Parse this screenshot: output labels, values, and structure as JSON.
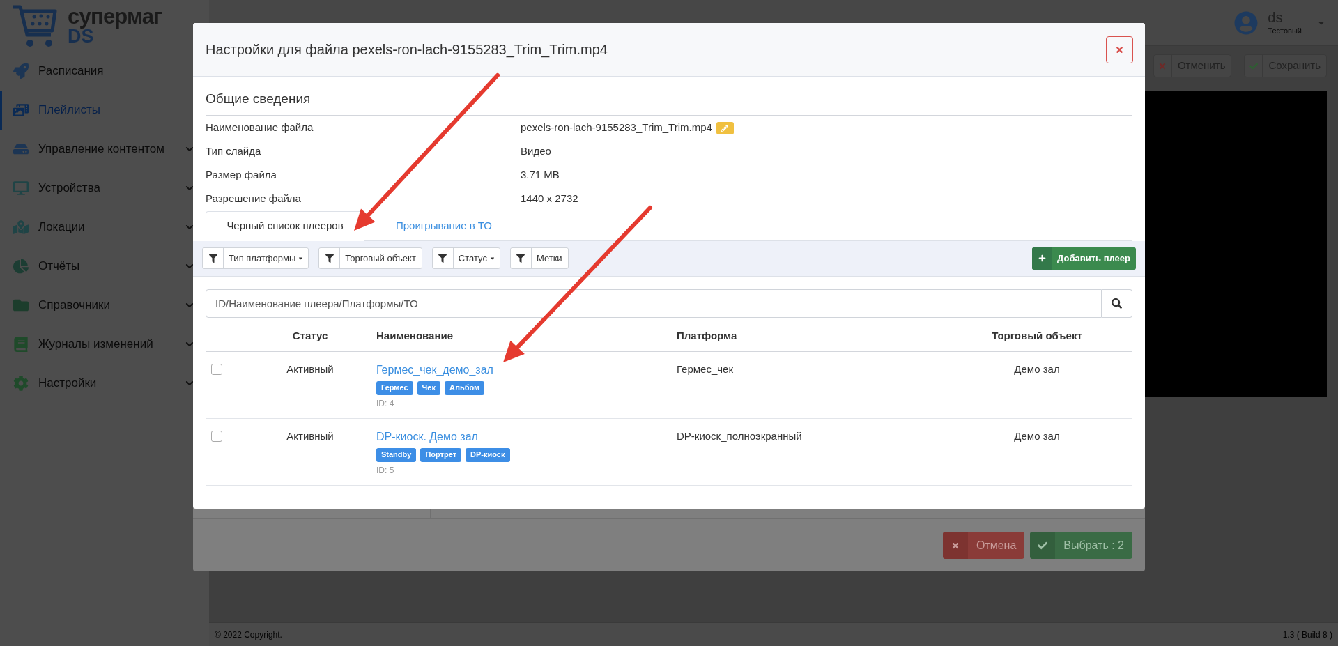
{
  "logo": {
    "line1": "супермаг",
    "line2": "DS"
  },
  "sidebar": {
    "items": [
      {
        "label": "Расписания",
        "selected": false,
        "expandable": false
      },
      {
        "label": "Плейлисты",
        "selected": true,
        "expandable": false
      },
      {
        "label": "Управление контентом",
        "selected": false,
        "expandable": true
      },
      {
        "label": "Устройства",
        "selected": false,
        "expandable": true
      },
      {
        "label": "Локации",
        "selected": false,
        "expandable": true
      },
      {
        "label": "Отчёты",
        "selected": false,
        "expandable": true
      },
      {
        "label": "Справочники",
        "selected": false,
        "expandable": true
      },
      {
        "label": "Журналы изменений",
        "selected": false,
        "expandable": true
      },
      {
        "label": "Настройки",
        "selected": false,
        "expandable": true
      }
    ]
  },
  "user": {
    "name": "ds",
    "role": "Тестовый"
  },
  "toolbar": [
    {
      "label": "Отменить",
      "kind": "cancel"
    },
    {
      "label": "Сохранить",
      "kind": "save"
    }
  ],
  "footer": {
    "copyright": "© 2022 Copyright.",
    "version": "1.3 ( Build 8 )"
  },
  "back_dialog": {
    "buttons": [
      {
        "label": "Отмена",
        "kind": "cancel"
      },
      {
        "label": "Выбрать : 2",
        "kind": "confirm"
      }
    ]
  },
  "dialog": {
    "title": "Настройки для файла pexels-ron-lach-9155283_Trim_Trim.mp4",
    "section_title": "Общие сведения",
    "info": [
      {
        "label": "Наименование файла",
        "value": "pexels-ron-lach-9155283_Trim_Trim.mp4",
        "editable": true
      },
      {
        "label": "Тип слайда",
        "value": "Видео",
        "editable": false
      },
      {
        "label": "Размер файла",
        "value": "3.71 MB",
        "editable": false
      },
      {
        "label": "Разрешение файла",
        "value": "1440 x 2732",
        "editable": false
      }
    ],
    "tabs": [
      {
        "label": "Черный список плееров",
        "selected": true
      },
      {
        "label": "Проигрывание в ТО",
        "selected": false
      }
    ],
    "filters": [
      {
        "label": "Тип платформы",
        "dropdown": true
      },
      {
        "label": "Торговый объект",
        "dropdown": false
      },
      {
        "label": "Статус",
        "dropdown": true
      },
      {
        "label": "Метки",
        "dropdown": false
      }
    ],
    "add_button": "Добавить плеер",
    "search": {
      "placeholder": "ID/Наименование плеера/Платформы/ТО"
    },
    "table": {
      "columns": [
        "Статус",
        "Наименование",
        "Платформа",
        "Торговый объект"
      ],
      "rows": [
        {
          "checked": false,
          "status": "Активный",
          "name": "Гермес_чек_демо_зал",
          "tags": [
            "Гермес",
            "Чек",
            "Альбом"
          ],
          "id": "ID: 4",
          "platform": "Гермес_чек",
          "store": "Демо зал"
        },
        {
          "checked": false,
          "status": "Активный",
          "name": "DP-киоск. Демо зал",
          "tags": [
            "Standby",
            "Портрет",
            "DP-киоск"
          ],
          "id": "ID: 5",
          "platform": "DP-киоск_полноэкранный",
          "store": "Демо зал"
        }
      ]
    }
  }
}
